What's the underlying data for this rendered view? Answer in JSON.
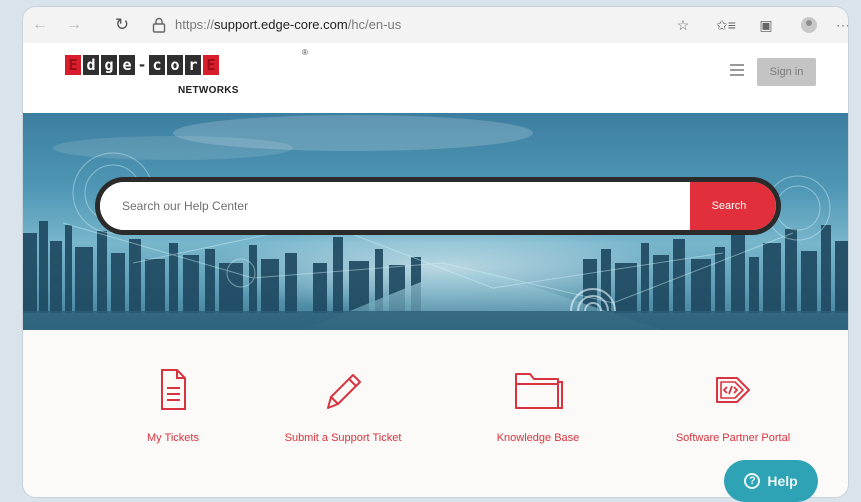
{
  "browser": {
    "url_prefix": "https://",
    "url_domain": "support.edge-core.com",
    "url_path": "/hc/en-us"
  },
  "header": {
    "logo_letters": [
      "E",
      "d",
      "g",
      "e",
      "-",
      "c",
      "o",
      "r",
      "E"
    ],
    "logo_sub": "NETWORKS",
    "logo_reg": "®",
    "sign_in_label": "Sign in"
  },
  "search": {
    "placeholder": "Search our Help Center",
    "button_label": "Search"
  },
  "categories": [
    {
      "label": "My Tickets",
      "icon": "document-icon"
    },
    {
      "label": "Submit a Support Ticket",
      "icon": "pencil-icon"
    },
    {
      "label": "Knowledge Base",
      "icon": "folder-icon"
    },
    {
      "label": "Software Partner Portal",
      "icon": "code-icon"
    }
  ],
  "help_widget": {
    "label": "Help"
  },
  "colors": {
    "accent_red": "#e1303c",
    "help_teal": "#2ea3b6"
  }
}
